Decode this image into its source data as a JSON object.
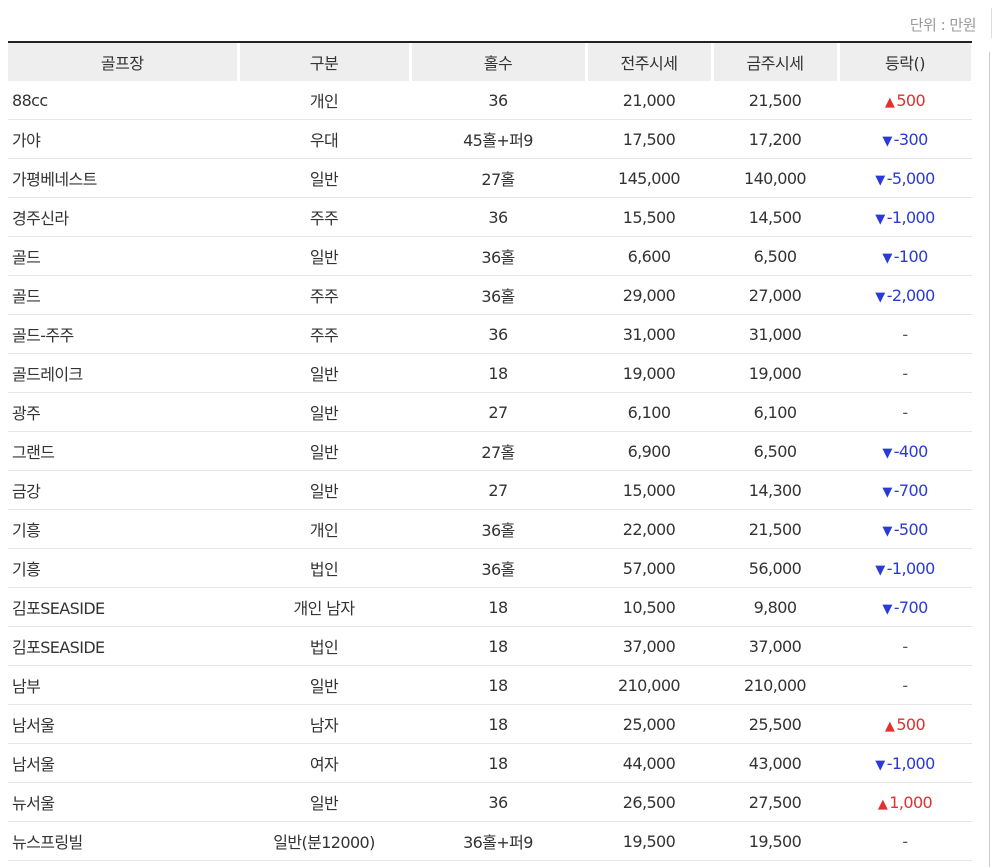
{
  "unit_label": "단위 : 만원",
  "colors": {
    "up": "#e03030",
    "down": "#2a3ad8",
    "header_bg": "#eeeeee"
  },
  "table": {
    "headers": [
      "골프장",
      "구분",
      "홀수",
      "전주시세",
      "금주시세",
      "등락()"
    ],
    "rows": [
      {
        "name": "88cc",
        "type": "개인",
        "holes": "36",
        "prev": "21,000",
        "curr": "21,500",
        "dir": "up",
        "change": "500"
      },
      {
        "name": "가야",
        "type": "우대",
        "holes": "45홀+퍼9",
        "prev": "17,500",
        "curr": "17,200",
        "dir": "down",
        "change": "-300"
      },
      {
        "name": "가평베네스트",
        "type": "일반",
        "holes": "27홀",
        "prev": "145,000",
        "curr": "140,000",
        "dir": "down",
        "change": "-5,000"
      },
      {
        "name": "경주신라",
        "type": "주주",
        "holes": "36",
        "prev": "15,500",
        "curr": "14,500",
        "dir": "down",
        "change": "-1,000"
      },
      {
        "name": "골드",
        "type": "일반",
        "holes": "36홀",
        "prev": "6,600",
        "curr": "6,500",
        "dir": "down",
        "change": "-100"
      },
      {
        "name": "골드",
        "type": "주주",
        "holes": "36홀",
        "prev": "29,000",
        "curr": "27,000",
        "dir": "down",
        "change": "-2,000"
      },
      {
        "name": "골드-주주",
        "type": "주주",
        "holes": "36",
        "prev": "31,000",
        "curr": "31,000",
        "dir": "flat",
        "change": "-"
      },
      {
        "name": "골드레이크",
        "type": "일반",
        "holes": "18",
        "prev": "19,000",
        "curr": "19,000",
        "dir": "flat",
        "change": "-"
      },
      {
        "name": "광주",
        "type": "일반",
        "holes": "27",
        "prev": "6,100",
        "curr": "6,100",
        "dir": "flat",
        "change": "-"
      },
      {
        "name": "그랜드",
        "type": "일반",
        "holes": "27홀",
        "prev": "6,900",
        "curr": "6,500",
        "dir": "down",
        "change": "-400"
      },
      {
        "name": "금강",
        "type": "일반",
        "holes": "27",
        "prev": "15,000",
        "curr": "14,300",
        "dir": "down",
        "change": "-700"
      },
      {
        "name": "기흥",
        "type": "개인",
        "holes": "36홀",
        "prev": "22,000",
        "curr": "21,500",
        "dir": "down",
        "change": "-500"
      },
      {
        "name": "기흥",
        "type": "법인",
        "holes": "36홀",
        "prev": "57,000",
        "curr": "56,000",
        "dir": "down",
        "change": "-1,000"
      },
      {
        "name": "김포SEASIDE",
        "type": "개인 남자",
        "holes": "18",
        "prev": "10,500",
        "curr": "9,800",
        "dir": "down",
        "change": "-700"
      },
      {
        "name": "김포SEASIDE",
        "type": "법인",
        "holes": "18",
        "prev": "37,000",
        "curr": "37,000",
        "dir": "flat",
        "change": "-"
      },
      {
        "name": "남부",
        "type": "일반",
        "holes": "18",
        "prev": "210,000",
        "curr": "210,000",
        "dir": "flat",
        "change": "-"
      },
      {
        "name": "남서울",
        "type": "남자",
        "holes": "18",
        "prev": "25,000",
        "curr": "25,500",
        "dir": "up",
        "change": "500"
      },
      {
        "name": "남서울",
        "type": "여자",
        "holes": "18",
        "prev": "44,000",
        "curr": "43,000",
        "dir": "down",
        "change": "-1,000"
      },
      {
        "name": "뉴서울",
        "type": "일반",
        "holes": "36",
        "prev": "26,500",
        "curr": "27,500",
        "dir": "up",
        "change": "1,000"
      },
      {
        "name": "뉴스프링빌",
        "type": "일반(분12000)",
        "holes": "36홀+퍼9",
        "prev": "19,500",
        "curr": "19,500",
        "dir": "flat",
        "change": "-"
      }
    ]
  }
}
